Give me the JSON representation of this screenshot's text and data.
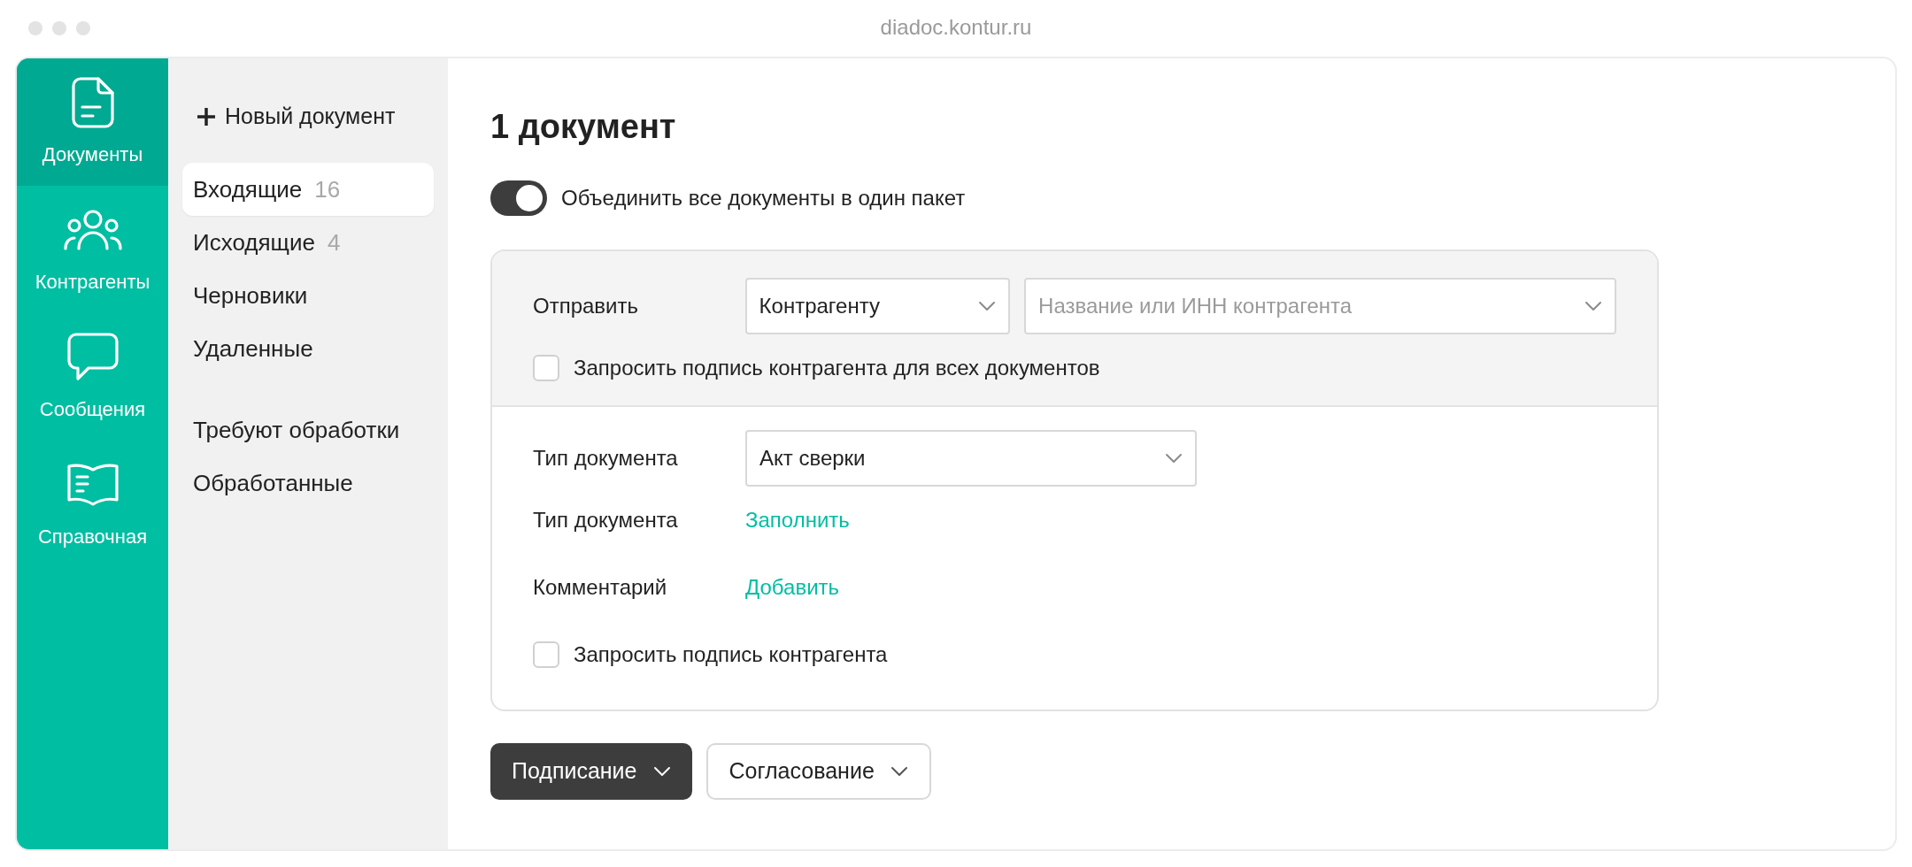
{
  "window": {
    "title": "diadoc.kontur.ru"
  },
  "nav": [
    {
      "label": "Документы",
      "selected": true
    },
    {
      "label": "Контрагенты",
      "selected": false
    },
    {
      "label": "Сообщения",
      "selected": false
    },
    {
      "label": "Справочная",
      "selected": false
    }
  ],
  "sidebar": {
    "new_document": "Новый документ",
    "groups": [
      [
        {
          "label": "Входящие",
          "count": "16",
          "selected": true
        },
        {
          "label": "Исходящие",
          "count": "4",
          "selected": false
        },
        {
          "label": "Черновики",
          "selected": false
        },
        {
          "label": "Удаленные",
          "selected": false
        }
      ],
      [
        {
          "label": "Требуют обработки",
          "selected": false
        },
        {
          "label": "Обработанные",
          "selected": false
        }
      ]
    ]
  },
  "main": {
    "title": "1 документ",
    "toggle": {
      "label": "Объединить все документы в один пакет",
      "on": true
    },
    "send": {
      "label": "Отправить",
      "recipient_type": {
        "value": "Контрагенту"
      },
      "recipient": {
        "placeholder": "Название или ИНН контрагента"
      },
      "checkbox": {
        "label": "Запросить подпись контрагента для всех документов",
        "checked": false
      }
    },
    "rows": [
      {
        "kind": "select",
        "label": "Тип документа",
        "value": "Акт сверки"
      },
      {
        "kind": "link",
        "label": "Тип документа",
        "link": "Заполнить"
      },
      {
        "kind": "link",
        "label": "Комментарий",
        "link": "Добавить"
      },
      {
        "kind": "checkbox",
        "label": "Запросить подпись контрагента",
        "checked": false
      }
    ],
    "actions": [
      {
        "label": "Подписание",
        "primary": true
      },
      {
        "label": "Согласование",
        "primary": false
      }
    ]
  }
}
